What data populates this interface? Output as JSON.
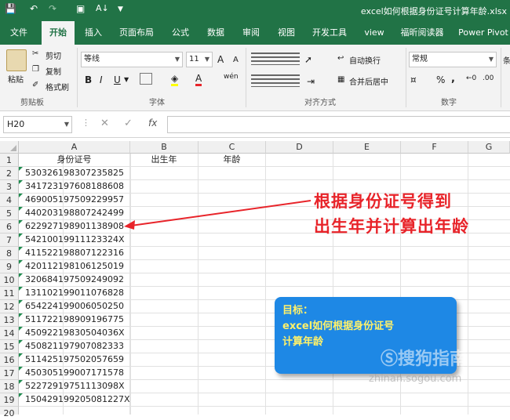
{
  "window": {
    "doc_title": "excel如何根据身份证号计算年龄.xlsx"
  },
  "ribbon_tabs": [
    "文件",
    "开始",
    "插入",
    "页面布局",
    "公式",
    "数据",
    "审阅",
    "视图",
    "开发工具",
    "view",
    "福昕阅读器",
    "Power Pivot"
  ],
  "ribbon": {
    "clipboard": {
      "paste": "粘贴",
      "cut": "剪切",
      "copy": "复制",
      "format_painter": "格式刷",
      "label": "剪贴板"
    },
    "font": {
      "name": "等线",
      "size": "11",
      "grow": "A",
      "shrink": "A",
      "bold": "B",
      "italic": "I",
      "underline": "U",
      "wen": "wén",
      "label": "字体"
    },
    "alignment": {
      "wrap": "自动换行",
      "merge": "合并后居中",
      "label": "对齐方式"
    },
    "number": {
      "format": "常规",
      "percent": "%",
      "comma": ",",
      "label": "数字"
    },
    "more": "条"
  },
  "formula_bar": {
    "name_box": "H20",
    "cancel": "✕",
    "confirm": "✓",
    "fx": "fx",
    "value": ""
  },
  "columns": [
    "A",
    "B",
    "C",
    "D",
    "E",
    "F",
    "G"
  ],
  "headers": {
    "a1": "身份证号",
    "b1": "出生年",
    "c1": "年龄"
  },
  "ids": [
    "530326198307235825",
    "341723197608188608",
    "469005197509229957",
    "440203198807242499",
    "622927198901138908",
    "54210019911123324X",
    "411522198807122316",
    "420112198106125019",
    "320684197509249092",
    "131102199011076828",
    "654224199006050250",
    "511722198909196775",
    "45092219830504036X",
    "450821197907082333",
    "511425197502057659",
    "450305199007171578",
    "52272919751113098X",
    "150429199205081227X"
  ],
  "rows": [
    "1",
    "2",
    "3",
    "4",
    "5",
    "6",
    "7",
    "8",
    "9",
    "10",
    "11",
    "12",
    "13",
    "14",
    "15",
    "16",
    "17",
    "18",
    "19",
    "20"
  ],
  "annotation": {
    "line1": "根据身份证号得到",
    "line2": "出生年并计算出年龄",
    "color": "#e8242a"
  },
  "goal": {
    "title": "目标：",
    "line1": "excel如何根据身份证号",
    "line2": "计算年龄"
  },
  "watermark": {
    "brand": "搜狗指南",
    "url": "zhinan.sogou.com"
  },
  "colors": {
    "excel_green": "#217346",
    "goal_bg": "#1e88e5",
    "goal_text": "#fff16a"
  }
}
